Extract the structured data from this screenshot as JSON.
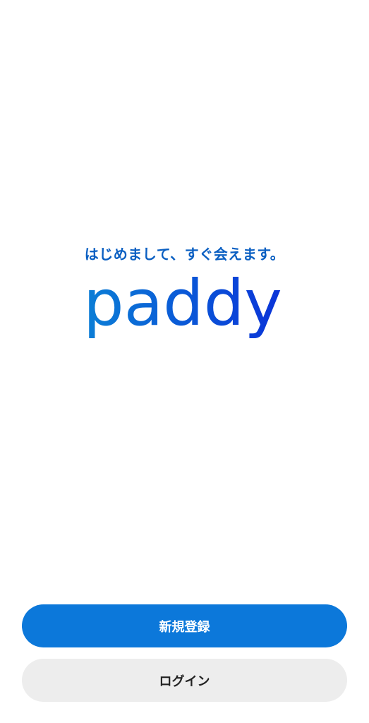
{
  "welcome": {
    "tagline": "はじめまして、すぐ会えます。",
    "logo_text": "paddy"
  },
  "actions": {
    "signup_label": "新規登録",
    "login_label": "ログイン"
  },
  "colors": {
    "tagline": "#0a5fc2",
    "logo_gradient_start": "#0b7fd6",
    "logo_gradient_end": "#0a33d8",
    "primary_button": "#0c78da",
    "secondary_button": "#ededed"
  }
}
